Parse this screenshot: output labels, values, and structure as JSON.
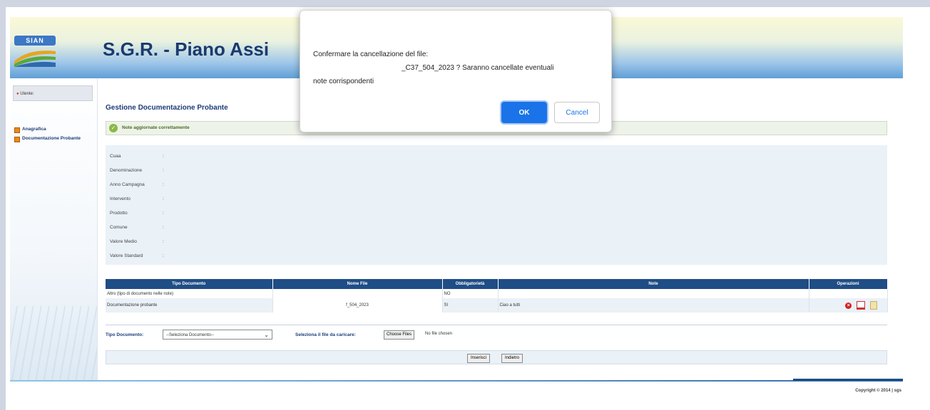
{
  "header": {
    "logo_text": "SIAN",
    "app_title": "S.G.R. - Piano Assi"
  },
  "sidebar": {
    "user_label": "Utente:",
    "items": [
      {
        "label": "Anagrafica"
      },
      {
        "label": "Documentazione Probante"
      }
    ]
  },
  "main": {
    "page_title": "Gestione Documentazione Probante",
    "success_message": "Note aggiornate correttamente",
    "info_fields": [
      {
        "label": "Cuaa",
        "sep": ":"
      },
      {
        "label": "Denominazione",
        "sep": ":"
      },
      {
        "label": "Anno Campagna",
        "sep": ":"
      },
      {
        "label": "Intervento",
        "sep": ":"
      },
      {
        "label": "Prodotto",
        "sep": ":"
      },
      {
        "label": "Comune",
        "sep": ":"
      },
      {
        "label": "Valore Medio",
        "sep": ":"
      },
      {
        "label": "Valore Standard",
        "sep": ":"
      }
    ],
    "table": {
      "columns": [
        "Tipo Documento",
        "Nome File",
        "Obbligatorietà",
        "Note",
        "Operazioni"
      ],
      "rows": [
        {
          "tipo": "Altro (tipo di documento nelle note)",
          "file": "",
          "obbligatorieta": "NO",
          "note": ""
        },
        {
          "tipo": "Documentazione probante",
          "file": "f_504_2023",
          "obbligatorieta": "SI",
          "note": "Ciao a tutti"
        }
      ],
      "operation_icons": [
        "delete-icon",
        "edit-icon",
        "note-icon"
      ]
    },
    "upload": {
      "tipo_label": "Tipo Documento:",
      "select_value": "--Seleziona Documento--",
      "file_label": "Seleziona il file da caricare:",
      "choose_button": "Choose Files",
      "no_file_text": "No file chosen"
    },
    "buttons": {
      "insert": "Inserisci",
      "back": "Indietro"
    }
  },
  "footer": {
    "copyright": "Copyright © 2014 | sgs"
  },
  "dialog": {
    "line1": "Confermare la cancellazione del file:",
    "line2": "_C37_504_2023 ? Saranno cancellate eventuali",
    "line3": "note corrispondenti",
    "ok_label": "OK",
    "cancel_label": "Cancel"
  },
  "colors": {
    "accent": "#1a73e8",
    "header_blue": "#1f4d86",
    "nav_bullet": "#e88a1a",
    "success": "#8ab844"
  }
}
